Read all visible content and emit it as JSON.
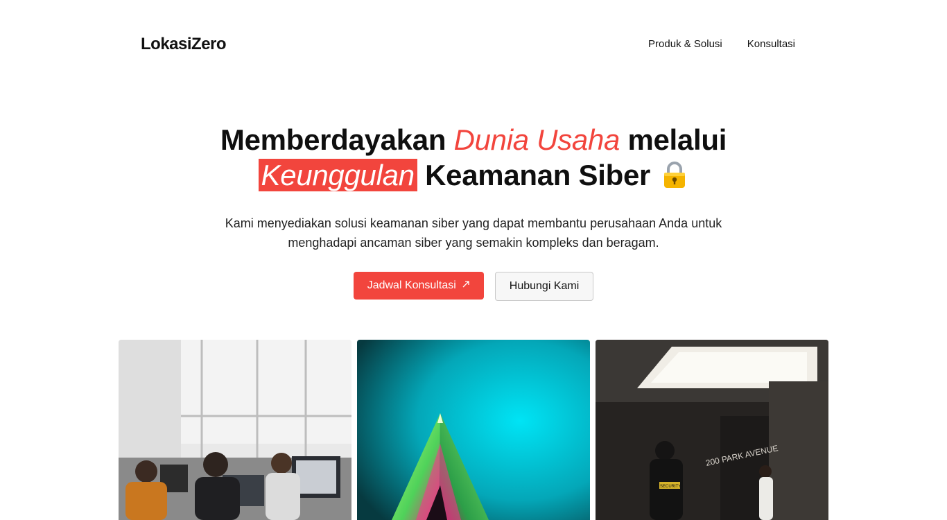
{
  "brand": {
    "logo": "LokasiZero"
  },
  "nav": {
    "items": [
      {
        "label": "Produk & Solusi"
      },
      {
        "label": "Konsultasi"
      }
    ]
  },
  "hero": {
    "title_part1": "Memberdayakan",
    "title_accent1": "Dunia Usaha",
    "title_part2": "melalui",
    "title_accent2": "Keunggulan",
    "title_part3": "Keamanan Siber",
    "subtitle": "Kami menyediakan solusi keamanan siber yang dapat membantu perusahaan Anda untuk menghadapi ancaman siber yang semakin kompleks dan beragam.",
    "primary_button": "Jadwal Konsultasi",
    "secondary_button": "Hubungi Kami"
  },
  "colors": {
    "accent": "#f2453d",
    "text": "#111111",
    "background": "#ffffff"
  },
  "gallery": {
    "images": [
      {
        "icon": "office-workers-image"
      },
      {
        "icon": "crystal-pyramid-image"
      },
      {
        "icon": "security-guard-lobby-image"
      }
    ]
  },
  "lobby_sign": "200 PARK AVENUE",
  "security_label": "SECURITY"
}
